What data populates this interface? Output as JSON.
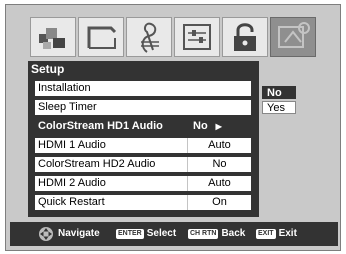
{
  "menu_icons": [
    {
      "name": "picture-icon",
      "active": false
    },
    {
      "name": "screen-icon",
      "active": false
    },
    {
      "name": "audio-icon",
      "active": false
    },
    {
      "name": "preferences-icon",
      "active": false
    },
    {
      "name": "lock-icon",
      "active": false
    },
    {
      "name": "setup-icon",
      "active": true
    }
  ],
  "panel": {
    "title": "Setup",
    "items": [
      {
        "label": "Installation",
        "value": ""
      },
      {
        "label": "Sleep Timer",
        "value": ""
      },
      {
        "label": "ColorStream HD1 Audio",
        "value": "No",
        "selected": true
      },
      {
        "label": "HDMI 1 Audio",
        "value": "Auto"
      },
      {
        "label": "ColorStream HD2 Audio",
        "value": "No"
      },
      {
        "label": "HDMI 2 Audio",
        "value": "Auto"
      },
      {
        "label": "Quick Restart",
        "value": "On"
      }
    ]
  },
  "options": [
    {
      "label": "No",
      "selected": true
    },
    {
      "label": "Yes",
      "selected": false
    }
  ],
  "footer": {
    "navigate": "Navigate",
    "enter_key": "ENTER",
    "select": "Select",
    "chrtn_key": "CH RTN",
    "back": "Back",
    "exit_key": "EXIT",
    "exit": "Exit"
  },
  "colors": {
    "background": "#c9c9c9",
    "panel": "#333333",
    "row": "#ffffff"
  }
}
